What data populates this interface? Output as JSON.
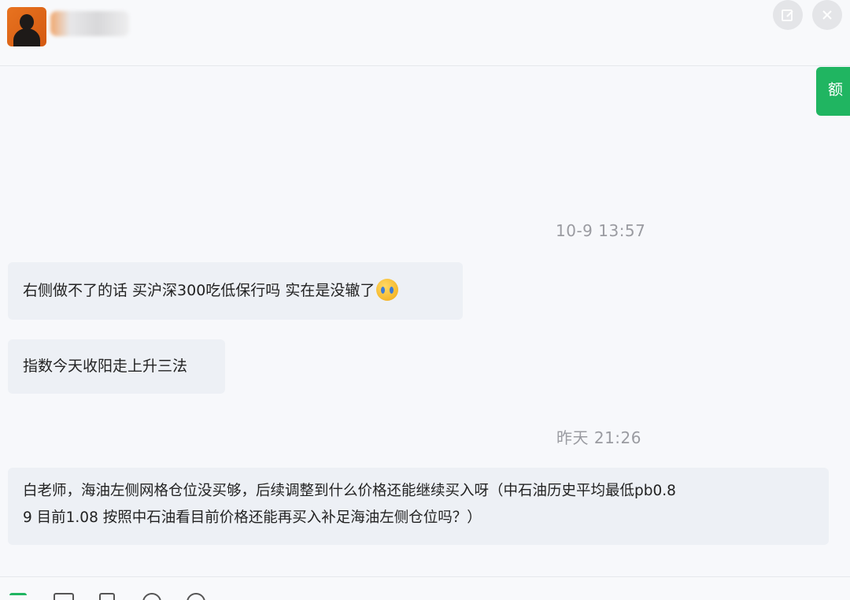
{
  "header": {
    "edit_icon": "edit-icon",
    "close_icon": "close-icon"
  },
  "side_tab": {
    "label": "额"
  },
  "messages": [
    {
      "type": "timestamp",
      "text": "10-9 13:57"
    },
    {
      "type": "bubble",
      "text": "右侧做不了的话 买沪深300吃低保行吗 实在是没辙了",
      "emoji": "crying-face-icon"
    },
    {
      "type": "bubble",
      "text": "指数今天收阳走上升三法"
    },
    {
      "type": "timestamp",
      "text": "昨天 21:26"
    },
    {
      "type": "bubble",
      "lines": [
        "白老师，海油左侧网格仓位没买够，后续调整到什么价格还能继续买入呀（中石油历史平均最低pb0.8",
        "9 目前1.08 按照中石油看目前价格还能再买入补足海油左侧仓位吗？）"
      ]
    }
  ],
  "toolbar": {
    "icons": [
      "text-format-icon",
      "folder-icon",
      "document-icon",
      "emoji-icon",
      "clock-icon"
    ]
  },
  "colors": {
    "accent": "#20b561",
    "bubble": "#edf0f5",
    "background": "#f7f8fb",
    "timestamp": "#9a9ba1"
  }
}
